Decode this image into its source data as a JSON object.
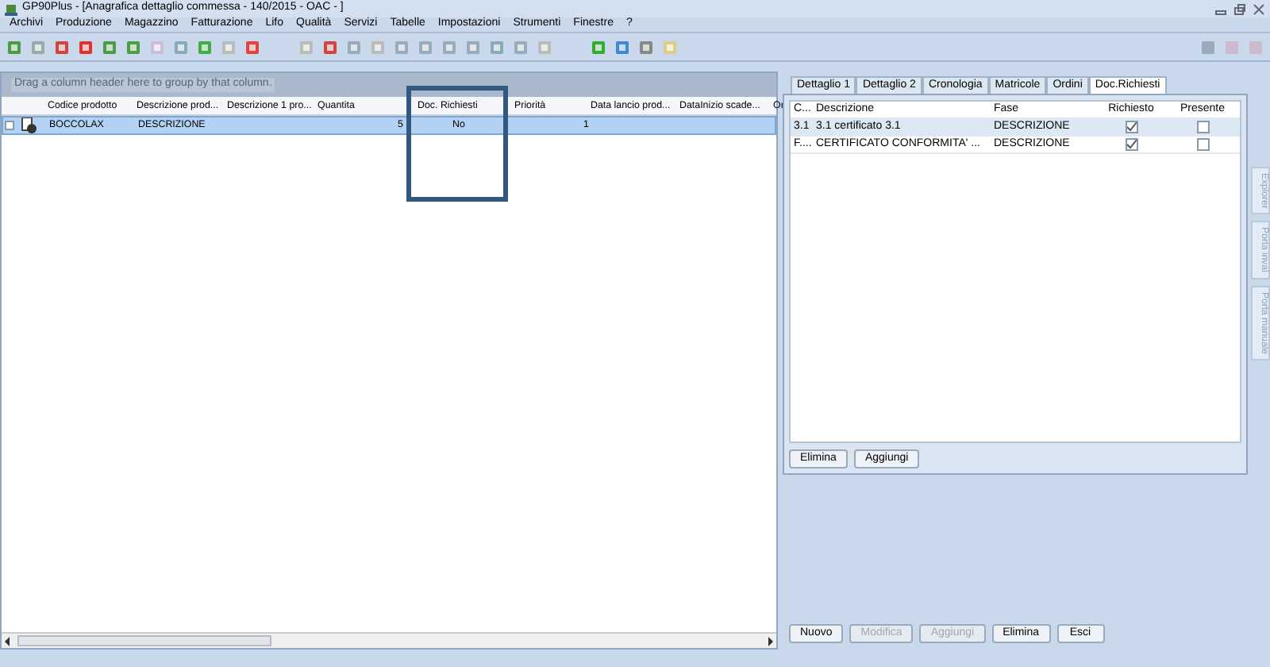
{
  "window": {
    "title": "GP90Plus - [Anagrafica dettaglio commessa - 140/2015 - OAC - ]"
  },
  "menu": [
    "Archivi",
    "Produzione",
    "Magazzino",
    "Fatturazione",
    "Lifo",
    "Qualità",
    "Servizi",
    "Tabelle",
    "Impostazioni",
    "Strumenti",
    "Finestre",
    "?"
  ],
  "grid": {
    "group_hint": "Drag a column header here to group by that column.",
    "columns": [
      "Codice prodotto",
      "Descrizione prod...",
      "Descrizione 1 pro...",
      "Quantita",
      "Doc. Richiesti",
      "Priorità",
      "Data lancio prod...",
      "DataInizio scade...",
      "Or"
    ],
    "rows": [
      {
        "selected": true,
        "checked": false,
        "cells": [
          "BOCCOLAX",
          "DESCRIZIONE",
          "",
          "5",
          "No",
          "1",
          "",
          "",
          ""
        ]
      }
    ]
  },
  "detail_tabs": [
    {
      "label": "Dettaglio 1",
      "selected": false
    },
    {
      "label": "Dettaglio 2",
      "selected": false
    },
    {
      "label": "Cronologia",
      "selected": false
    },
    {
      "label": "Matricole",
      "selected": false
    },
    {
      "label": "Ordini",
      "selected": false
    },
    {
      "label": "Doc.Richiesti",
      "selected": true
    }
  ],
  "doc_table": {
    "columns": [
      "C...",
      "Descrizione",
      "Fase",
      "Richiesto",
      "Presente"
    ],
    "rows": [
      {
        "selected": true,
        "cells": [
          "3.1",
          "3.1 certificato 3.1",
          "DESCRIZIONE"
        ],
        "richiesto": true,
        "presente": false
      },
      {
        "selected": false,
        "cells": [
          "F....",
          "CERTIFICATO CONFORMITA' ...",
          "DESCRIZIONE"
        ],
        "richiesto": true,
        "presente": false
      }
    ]
  },
  "doc_buttons": [
    "Elimina",
    "Aggiungi"
  ],
  "side_tabs": [
    "Explorer",
    "Porta inval",
    "Porta manuale"
  ],
  "actions": [
    {
      "label": "Nuovo",
      "disabled": false
    },
    {
      "label": "Modifica",
      "disabled": true
    },
    {
      "label": "Aggiungi",
      "disabled": true
    },
    {
      "label": "Elimina",
      "disabled": false
    },
    {
      "label": "Esci",
      "disabled": false
    }
  ]
}
